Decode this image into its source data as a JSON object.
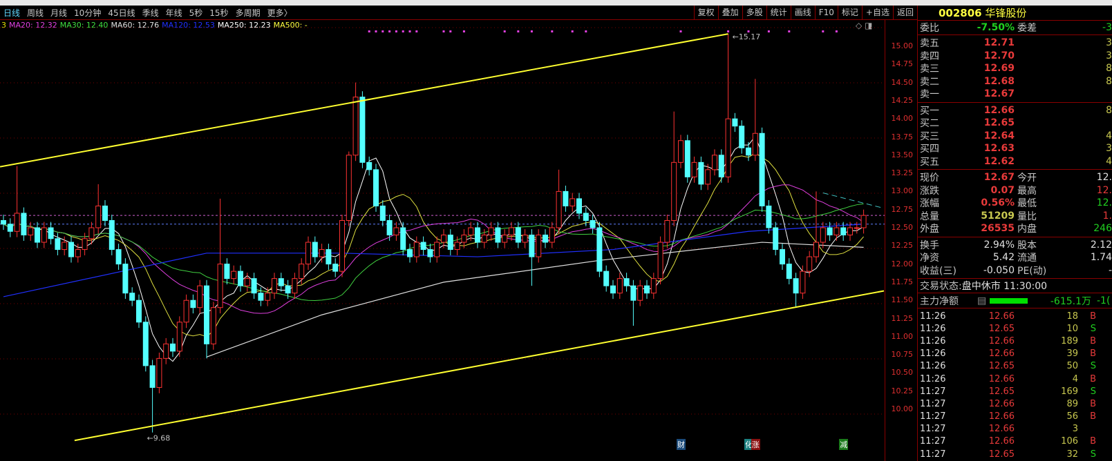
{
  "toolbar": {
    "periods": [
      "日线",
      "周线",
      "月线",
      "10分钟",
      "45日线",
      "季线",
      "年线",
      "5秒",
      "15秒",
      "多周期",
      "更多〉"
    ],
    "tools": [
      "复权",
      "叠加",
      "多股",
      "统计",
      "画线",
      "F10",
      "标记",
      "+自选",
      "返回"
    ]
  },
  "legend": [
    {
      "text": "3",
      "color": "#e0e000"
    },
    {
      "text": "MA20: 12.32",
      "color": "#e040e0"
    },
    {
      "text": "MA30: 12.40",
      "color": "#40e040"
    },
    {
      "text": "MA60: 12.76",
      "color": "#e0e0e0"
    },
    {
      "text": "MA120: 12.53",
      "color": "#2030ff"
    },
    {
      "text": "MA250: 12.23",
      "color": "#ffffff"
    },
    {
      "text": "MA500: -",
      "color": "#ffff40"
    }
  ],
  "stock": {
    "code": "002806",
    "name": "华锋股份"
  },
  "weibi": {
    "label": "委比",
    "value": "-7.50%",
    "label2": "委差",
    "value2": "-3"
  },
  "asks": [
    {
      "label": "卖五",
      "price": "12.71",
      "vol": "3"
    },
    {
      "label": "卖四",
      "price": "12.70",
      "vol": "3"
    },
    {
      "label": "卖三",
      "price": "12.69",
      "vol": "8"
    },
    {
      "label": "卖二",
      "price": "12.68",
      "vol": "8"
    },
    {
      "label": "卖一",
      "price": "12.67",
      "vol": ""
    }
  ],
  "bids": [
    {
      "label": "买一",
      "price": "12.66",
      "vol": "8"
    },
    {
      "label": "买二",
      "price": "12.65",
      "vol": ""
    },
    {
      "label": "买三",
      "price": "12.64",
      "vol": "4"
    },
    {
      "label": "买四",
      "price": "12.63",
      "vol": "3"
    },
    {
      "label": "买五",
      "price": "12.62",
      "vol": "4"
    }
  ],
  "quote": [
    {
      "l": "现价",
      "v": "12.67",
      "l2": "今开",
      "v2": "12."
    },
    {
      "l": "涨跌",
      "v": "0.07",
      "l2": "最高",
      "v2": "12."
    },
    {
      "l": "涨幅",
      "v": "0.56%",
      "l2": "最低",
      "v2": "12."
    },
    {
      "l": "总量",
      "v": "51209",
      "l2": "量比",
      "v2": "1."
    },
    {
      "l": "外盘",
      "v": "26535",
      "l2": "内盘",
      "v2": "246"
    }
  ],
  "fund": [
    {
      "l": "换手",
      "v": "2.94%",
      "l2": "股本",
      "v2": "2.12"
    },
    {
      "l": "净资",
      "v": "5.42",
      "l2": "流通",
      "v2": "1.74"
    },
    {
      "l": "收益(三)",
      "v": "-0.050",
      "l2": "PE(动)",
      "v2": "-"
    }
  ],
  "status": {
    "label": "交易状态:",
    "value": "盘中休市 11:30:00"
  },
  "mainflow": {
    "label": "主力净额",
    "value": "-615.1万",
    "value2": "-1("
  },
  "trades": [
    [
      "11:26",
      "12.66",
      "18",
      "B"
    ],
    [
      "11:26",
      "12.65",
      "10",
      "S"
    ],
    [
      "11:26",
      "12.66",
      "189",
      "B"
    ],
    [
      "11:26",
      "12.66",
      "39",
      "B"
    ],
    [
      "11:26",
      "12.65",
      "50",
      "S"
    ],
    [
      "11:26",
      "12.66",
      "4",
      "B"
    ],
    [
      "11:27",
      "12.65",
      "169",
      "S"
    ],
    [
      "11:27",
      "12.66",
      "89",
      "B"
    ],
    [
      "11:27",
      "12.66",
      "56",
      "B"
    ],
    [
      "11:27",
      "12.66",
      "3",
      ""
    ],
    [
      "11:27",
      "12.66",
      "106",
      "B"
    ],
    [
      "11:27",
      "12.65",
      "32",
      "S"
    ]
  ],
  "badges": [
    {
      "text": "财",
      "color": "#1a4a7a",
      "index": 100
    },
    {
      "text": "化",
      "color": "#1a8080",
      "index": 110
    },
    {
      "text": "涨",
      "color": "#8a1010",
      "index": 111
    },
    {
      "text": "减",
      "color": "#1a7a1a",
      "index": 124
    }
  ],
  "chart_data": {
    "type": "candlestick",
    "ylim": [
      9.5,
      15.45
    ],
    "yticks": [
      10.0,
      10.25,
      10.5,
      10.75,
      11.0,
      11.25,
      11.5,
      11.75,
      12.0,
      12.25,
      12.5,
      12.75,
      13.0,
      13.25,
      13.5,
      13.75,
      14.0,
      14.25,
      14.5,
      14.75,
      15.0
    ],
    "close": [
      12.55,
      12.45,
      12.7,
      12.4,
      12.5,
      12.3,
      12.5,
      12.35,
      12.2,
      12.3,
      12.1,
      12.2,
      12.35,
      12.5,
      12.8,
      12.6,
      12.2,
      12.0,
      11.6,
      11.5,
      11.2,
      10.6,
      10.3,
      10.7,
      10.9,
      10.8,
      11.2,
      11.5,
      11.4,
      11.7,
      10.9,
      11.4,
      12.0,
      11.8,
      11.9,
      11.7,
      11.8,
      11.6,
      11.5,
      11.6,
      11.8,
      11.7,
      11.6,
      11.8,
      12.0,
      12.3,
      12.1,
      12.2,
      12.0,
      11.9,
      12.6,
      13.5,
      14.3,
      13.4,
      13.3,
      12.8,
      12.6,
      12.4,
      12.5,
      12.2,
      12.1,
      12.3,
      12.2,
      12.1,
      12.3,
      12.4,
      12.2,
      12.3,
      12.4,
      12.5,
      12.3,
      12.4,
      12.5,
      12.3,
      12.4,
      12.5,
      12.3,
      12.4,
      12.1,
      12.4,
      12.3,
      12.5,
      13.0,
      12.8,
      12.9,
      12.7,
      12.6,
      12.5,
      11.9,
      11.7,
      11.6,
      11.8,
      11.7,
      11.5,
      11.7,
      11.6,
      11.8,
      12.3,
      12.6,
      13.4,
      13.7,
      13.2,
      13.4,
      13.1,
      13.3,
      13.5,
      13.2,
      14.0,
      13.9,
      13.6,
      13.5,
      13.8,
      12.8,
      12.5,
      12.2,
      12.0,
      11.8,
      11.6,
      11.9,
      12.1,
      12.3,
      12.5,
      12.4,
      12.5,
      12.4,
      12.5,
      12.5,
      12.67
    ],
    "high_overrides": {
      "2": 13.35,
      "14": 13.1,
      "32": 12.9,
      "51": 13.55,
      "52": 14.5,
      "82": 13.3,
      "99": 14.1,
      "107": 15.17,
      "111": 14.55,
      "120": 13.0
    },
    "low_overrides": {
      "22": 9.68,
      "30": 10.7,
      "78": 11.7,
      "93": 11.15,
      "117": 11.4
    },
    "ma_periods": [
      {
        "name": "MA5",
        "n": 5,
        "color": "#ffffff"
      },
      {
        "name": "MA10",
        "n": 10,
        "color": "#e0e040"
      },
      {
        "name": "MA20",
        "n": 20,
        "color": "#e040e0"
      },
      {
        "name": "MA30",
        "n": 30,
        "color": "#40d040"
      }
    ],
    "ma120": [
      [
        0,
        11.55
      ],
      [
        30,
        12.15
      ],
      [
        50,
        12.15
      ],
      [
        70,
        12.1
      ],
      [
        90,
        12.2
      ],
      [
        110,
        12.45
      ],
      [
        127,
        12.55
      ]
    ],
    "ma250": [
      [
        30,
        10.72
      ],
      [
        47,
        11.3
      ],
      [
        65,
        11.75
      ],
      [
        88,
        12.05
      ],
      [
        112,
        12.3
      ],
      [
        127,
        12.23
      ]
    ],
    "trendlines": [
      {
        "from": [
          -0.5,
          13.34
        ],
        "to": [
          107,
          15.17
        ],
        "color": "#ffff30"
      },
      {
        "from": [
          10.5,
          9.57
        ],
        "to": [
          130,
          11.63
        ],
        "color": "#ffff30"
      },
      {
        "from": [
          121,
          12.98
        ],
        "to": [
          129.5,
          12.78
        ],
        "color": "#40c0c0",
        "dashed": true
      }
    ],
    "hlines": [
      {
        "value": 12.67,
        "color": "#d060d0"
      },
      {
        "value": 12.55,
        "color": "#6080ff"
      }
    ],
    "annotations": [
      {
        "text": "15.17",
        "index": 107,
        "value": 15.17
      },
      {
        "text": "9.68",
        "index": 22,
        "value": 9.68
      }
    ],
    "signals": [
      54,
      55,
      56,
      57,
      58,
      59,
      60,
      61,
      65,
      66,
      68,
      74,
      76,
      78,
      81,
      84,
      86,
      100,
      107,
      110,
      113,
      116,
      121,
      123
    ]
  }
}
